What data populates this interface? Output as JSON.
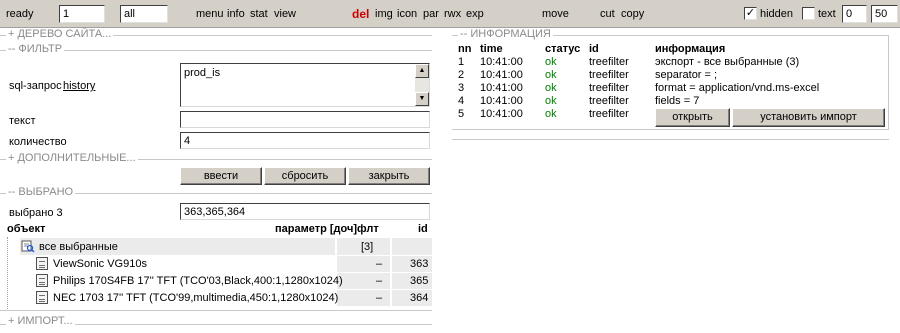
{
  "toolbar": {
    "status": "ready",
    "page_value": "1",
    "filter_value": "all",
    "menu": [
      "menu",
      "info",
      "stat",
      "view"
    ],
    "del": "del",
    "actions": [
      "img",
      "icon",
      "par",
      "rwx",
      "exp"
    ],
    "move": "move",
    "cut": "cut",
    "copy": "copy",
    "hidden_label": "hidden",
    "hidden_checked": "✓",
    "text_label": "text",
    "from_value": "0",
    "to_value": "50"
  },
  "left": {
    "tree_header": "+ ДЕРЕВО САЙТА...",
    "filter_header": "-- ФИЛЬТР",
    "sql_label": "sql-запрос",
    "history_link": "history",
    "sql_value": "prod_is",
    "text_label": "текст",
    "text_value": "",
    "count_label": "количество",
    "count_value": "4",
    "extra_header": "+ ДОПОЛНИТЕЛЬНЫЕ...",
    "buttons": {
      "enter": "ввести",
      "reset": "сбросить",
      "close": "закрыть"
    },
    "selected_header": "-- ВЫБРАНО",
    "selected_label": "выбрано 3",
    "selected_value": "363,365,364",
    "table": {
      "col_object": "объект",
      "col_param": "параметр [доч]флт",
      "col_id": "id",
      "group_label": "все выбранные",
      "group_count": "[3]",
      "rows": [
        {
          "name": "ViewSonic VG910s",
          "flag": "–",
          "id": "363"
        },
        {
          "name": "Philips 170S4FB 17'' TFT (TCO'03,Black,400:1,1280x1024)",
          "flag": "–",
          "id": "365"
        },
        {
          "name": "NEC 1703 17'' TFT (TCO'99,multimedia,450:1,1280x1024)",
          "flag": "–",
          "id": "364"
        }
      ]
    },
    "import_header": "+ ИМПОРТ..."
  },
  "right": {
    "info_header": "-- ИНФОРМАЦИЯ",
    "columns": {
      "nn": "nn",
      "time": "time",
      "status": "статус",
      "id": "id",
      "info": "информация"
    },
    "rows": [
      {
        "nn": "1",
        "time": "10:41:00",
        "status": "ok",
        "id": "treefilter",
        "info": "экспорт - все выбранные (3)"
      },
      {
        "nn": "2",
        "time": "10:41:00",
        "status": "ok",
        "id": "treefilter",
        "info": "separator = ;"
      },
      {
        "nn": "3",
        "time": "10:41:00",
        "status": "ok",
        "id": "treefilter",
        "info": "format = application/vnd.ms-excel"
      },
      {
        "nn": "4",
        "time": "10:41:00",
        "status": "ok",
        "id": "treefilter",
        "info": "fields = 7"
      },
      {
        "nn": "5",
        "time": "10:41:00",
        "status": "ok",
        "id": "treefilter",
        "info": ""
      }
    ],
    "buttons": {
      "open": "открыть",
      "install": "установить импорт"
    }
  },
  "colors": {
    "toolbar_bg": "#d4d0c8",
    "del": "#cc0000",
    "ok": "#008000",
    "section": "#8a8a8a"
  }
}
